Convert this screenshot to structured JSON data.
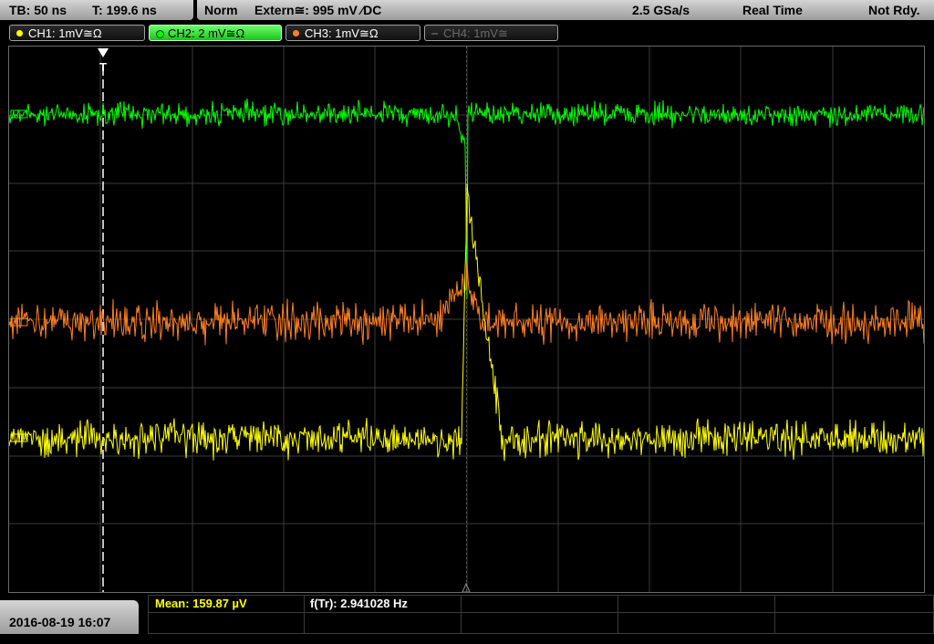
{
  "topbar": {
    "timebase": "TB: 50 ns",
    "trigger_time": "T: 199.6 ns",
    "mode": "Norm",
    "trigger_source": "Extern≅: 995 mV ⁄DC",
    "sample_rate": "2.5 GSa/s",
    "acq_mode": "Real Time",
    "status": "Not Rdy."
  },
  "channels": [
    {
      "label": "CH1: 1mV≅Ω",
      "color": "#ffff00",
      "active": false
    },
    {
      "label": "CH2: 2 mV≅Ω",
      "color": "#00ff00",
      "active": true
    },
    {
      "label": "CH3: 1mV≅Ω",
      "color": "#ff8020",
      "active": false
    },
    {
      "label": "CH4: 1mV≅",
      "color": "#606060",
      "active": false
    }
  ],
  "bottom": {
    "datetime": "2016-08-19 16:07",
    "mean_label": "Mean: 159.87 µV",
    "freq_label": "f(Tr): 2.941028 Hz"
  },
  "colors": {
    "ch1": "#ffff00",
    "ch2": "#00ff00",
    "ch3": "#ff8020",
    "grid": "#3a3a3a"
  }
}
